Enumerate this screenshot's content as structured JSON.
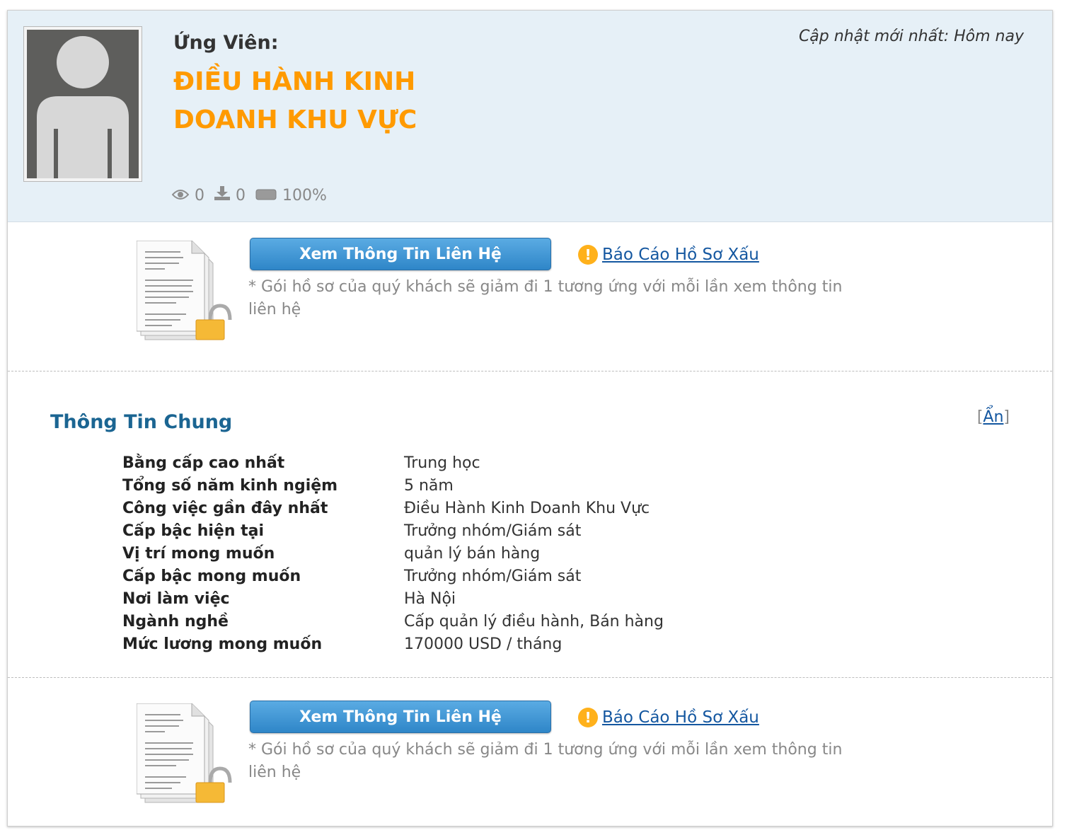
{
  "header": {
    "candidate_label": "Ứng Viên:",
    "job_title": "ĐIỀU HÀNH KINH DOANH KHU VỰC",
    "last_updated": "Cập nhật mới nhất: Hôm nay",
    "stats": {
      "views": "0",
      "downloads": "0",
      "completeness": "100%"
    }
  },
  "actions": {
    "view_contact_label": "Xem Thông Tin Liên Hệ",
    "report_label": "Báo Cáo Hồ Sơ Xấu",
    "note": "* Gói hồ sơ của quý khách sẽ giảm đi 1 tương ứng với mỗi lần xem thông tin liên hệ"
  },
  "general_info": {
    "title": "Thông Tin Chung",
    "toggle_open": "[",
    "toggle_label": "Ẩn",
    "toggle_close": "]",
    "rows": [
      {
        "label": "Bằng cấp cao nhất",
        "value": "Trung học"
      },
      {
        "label": "Tổng số năm kinh ngiệm",
        "value": "5 năm"
      },
      {
        "label": "Công việc gần đây nhất",
        "value": "Điều Hành Kinh Doanh Khu Vực"
      },
      {
        "label": "Cấp bậc hiện tại",
        "value": "Trưởng nhóm/Giám sát"
      },
      {
        "label": "Vị trí mong muốn",
        "value": "quản lý bán hàng"
      },
      {
        "label": "Cấp bậc mong muốn",
        "value": "Trưởng nhóm/Giám sát"
      },
      {
        "label": "Nơi làm việc",
        "value": "Hà Nội"
      },
      {
        "label": "Ngành nghề",
        "value": "Cấp quản lý điều hành, Bán hàng"
      },
      {
        "label": "Mức lương mong muốn",
        "value": "170000 USD / tháng"
      }
    ]
  },
  "colors": {
    "header_bg": "#e6f0f7",
    "title_orange": "#ff9a00",
    "section_blue": "#1b6592",
    "link_blue": "#1457a0",
    "button_blue": "#2f86c8",
    "warning_orange": "#ffb11b"
  },
  "icons": [
    "avatar-placeholder-icon",
    "eye-icon",
    "download-icon",
    "progress-icon",
    "locked-document-icon",
    "warning-icon"
  ]
}
